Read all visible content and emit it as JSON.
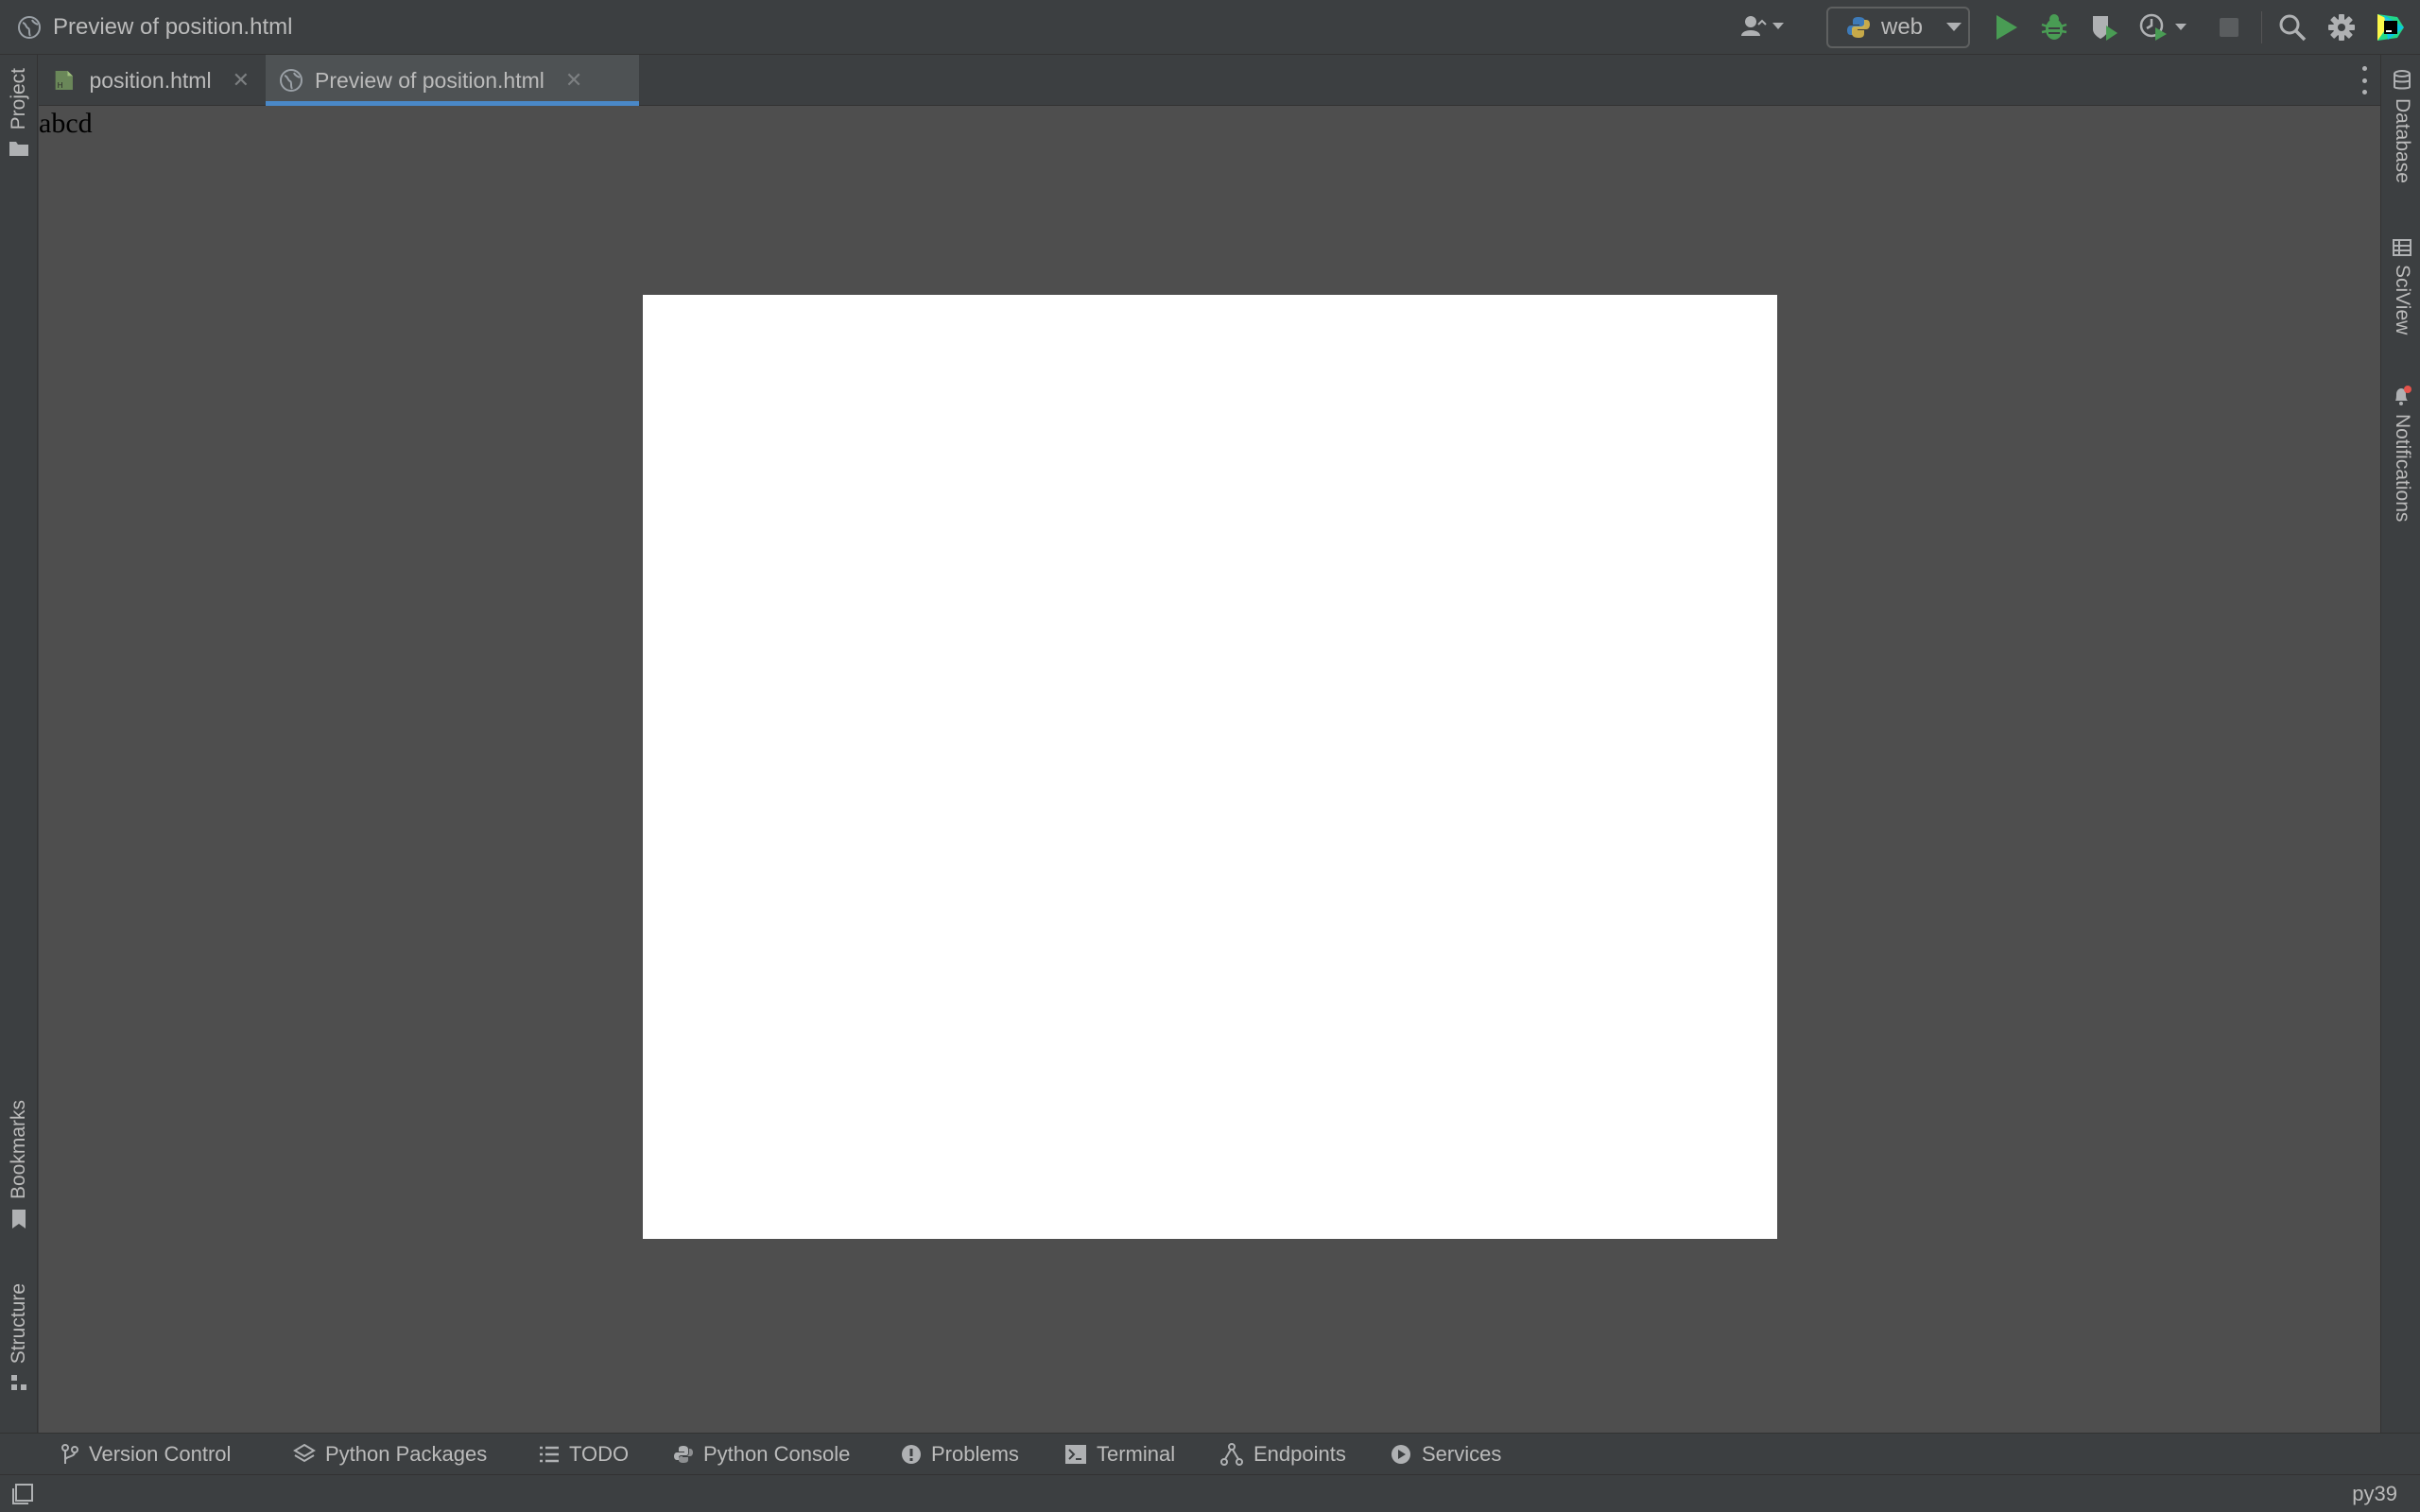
{
  "window": {
    "title": "Preview of position.html"
  },
  "toolbar": {
    "run_config_label": "web"
  },
  "tabs": [
    {
      "label": "position.html",
      "icon": "html-file-icon",
      "active": false
    },
    {
      "label": "Preview of position.html",
      "icon": "globe-icon",
      "active": true
    }
  ],
  "preview": {
    "content_text": "abcd"
  },
  "left_strip": {
    "top_items": [
      {
        "label": "Project",
        "icon": "folder-icon"
      }
    ],
    "bottom_items": [
      {
        "label": "Bookmarks",
        "icon": "bookmark-icon"
      },
      {
        "label": "Structure",
        "icon": "structure-icon"
      }
    ]
  },
  "right_strip": {
    "items": [
      {
        "label": "Database",
        "icon": "database-icon"
      },
      {
        "label": "SciView",
        "icon": "sciview-icon"
      },
      {
        "label": "Notifications",
        "icon": "bell-icon"
      }
    ]
  },
  "bottom_tools": [
    {
      "label": "Version Control",
      "icon": "branch-icon"
    },
    {
      "label": "Python Packages",
      "icon": "layers-icon"
    },
    {
      "label": "TODO",
      "icon": "list-icon"
    },
    {
      "label": "Python Console",
      "icon": "python-icon"
    },
    {
      "label": "Problems",
      "icon": "warning-icon"
    },
    {
      "label": "Terminal",
      "icon": "terminal-icon"
    },
    {
      "label": "Endpoints",
      "icon": "endpoints-icon"
    },
    {
      "label": "Services",
      "icon": "services-icon"
    }
  ],
  "status": {
    "interpreter": "py39"
  },
  "colors": {
    "accent": "#4a88c7",
    "run_green": "#499c54",
    "background": "#3c3f41",
    "preview_background": "#4e4e4e"
  }
}
